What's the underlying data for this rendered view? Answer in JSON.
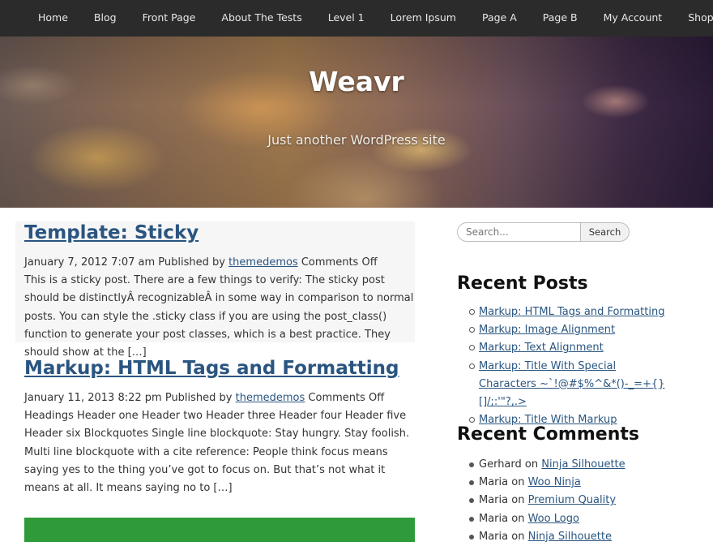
{
  "nav": {
    "items": [
      "Home",
      "Blog",
      "Front Page",
      "About The Tests",
      "Level 1",
      "Lorem Ipsum",
      "Page A",
      "Page B",
      "My Account",
      "Shop"
    ]
  },
  "header": {
    "site_title": "Weavr",
    "tagline": "Just another WordPress site"
  },
  "posts": [
    {
      "title": "Template: Sticky",
      "date": "January 7, 2012 7:07 am",
      "published_by": "Published by",
      "author": "themedemos",
      "comments": "Comments Off",
      "excerpt": "This is a sticky post. There are a few things to verify: The sticky post should be distinctlyÂ recognizableÂ in some way in comparison to normal posts. You can style the .sticky class if you are using the post_class() function to generate your post classes, which is a best practice. They should show at the […]"
    },
    {
      "title": "Markup: HTML Tags and Formatting",
      "date": "January 11, 2013 8:22 pm",
      "published_by": "Published by",
      "author": "themedemos",
      "comments": "Comments Off",
      "excerpt": "Headings Header one Header two Header three Header four Header five Header six Blockquotes Single line blockquote: Stay hungry. Stay foolish. Multi line blockquote with a cite reference: People think focus means saying yes to the thing you’ve got to focus on. But that’s not what it means at all. It means saying no to […]"
    }
  ],
  "search": {
    "placeholder": "Search...",
    "button_label": "Search"
  },
  "recent_posts": {
    "title": "Recent Posts",
    "items": [
      "Markup: HTML Tags and Formatting",
      "Markup: Image Alignment",
      "Markup: Text Alignment",
      "Markup: Title With Special Characters ~`!@#$%^&*()-_=+{}[]/;:'\"?,.>",
      "Markup: Title With Markup"
    ]
  },
  "recent_comments": {
    "title": "Recent Comments",
    "on_label": "on",
    "items": [
      {
        "author": "Gerhard",
        "post": "Ninja Silhouette"
      },
      {
        "author": "Maria",
        "post": "Woo Ninja"
      },
      {
        "author": "Maria",
        "post": "Premium Quality"
      },
      {
        "author": "Maria",
        "post": "Woo Logo"
      },
      {
        "author": "Maria",
        "post": "Ninja Silhouette"
      }
    ]
  },
  "colors": {
    "nav_bg": "#2b2b2b",
    "link": "#2a5580",
    "sticky_bg": "#f6f6f6",
    "accent_block": "#2e9a3a"
  }
}
